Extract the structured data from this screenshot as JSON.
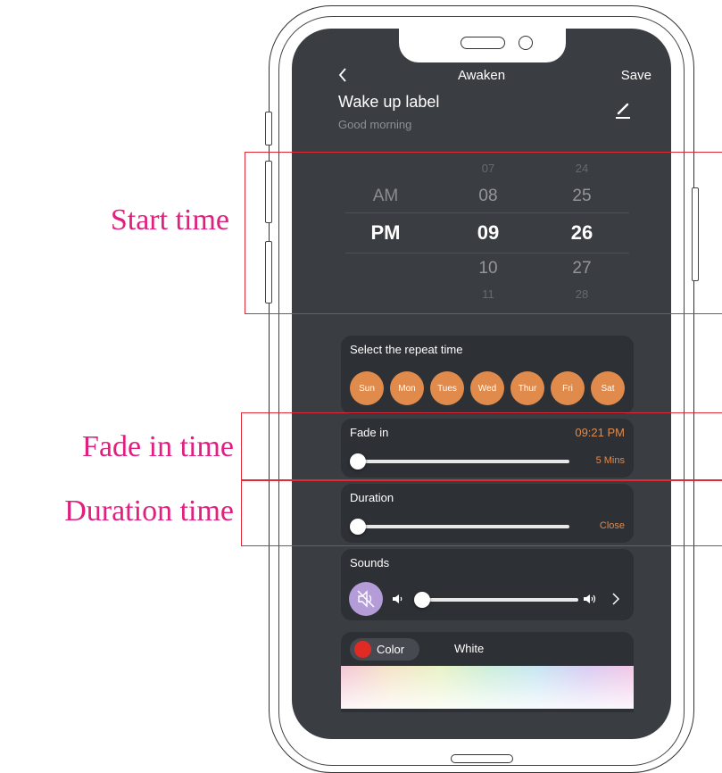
{
  "header": {
    "title": "Awaken",
    "save_label": "Save",
    "back_icon": "chevron-left-icon"
  },
  "wake_label": {
    "title": "Wake up label",
    "subtitle": "Good morning",
    "edit_icon": "pencil-icon"
  },
  "time_picker": {
    "period": [
      "AM",
      "PM"
    ],
    "hours": [
      "07",
      "08",
      "09",
      "10",
      "11"
    ],
    "minutes": [
      "24",
      "25",
      "26",
      "27",
      "28"
    ],
    "selected": {
      "period": "PM",
      "hour": "09",
      "minute": "26"
    }
  },
  "repeat": {
    "label": "Select the repeat time",
    "days": [
      "Sun",
      "Mon",
      "Tues",
      "Wed",
      "Thur",
      "Fri",
      "Sat"
    ]
  },
  "fade_in": {
    "label": "Fade in",
    "time": "09:21 PM",
    "value_label": "5 Mins",
    "slider_level": 0
  },
  "duration": {
    "label": "Duration",
    "value_label": "Close",
    "slider_level": 0
  },
  "sounds": {
    "label": "Sounds",
    "mute_icon": "speaker-muted-icon",
    "volume_level": 0
  },
  "color": {
    "chip_label": "Color",
    "white_label": "White",
    "selected_color": "#e02b25"
  },
  "annotations": {
    "start_time": "Start time",
    "fade_in_time": "Fade in time",
    "duration_time": "Duration time"
  },
  "colors": {
    "background": "#3a3d42",
    "card": "#2d3035",
    "accent": "#e08a4b",
    "annotation_text": "#e0207e",
    "annotation_box": "#e02a37",
    "sound_button": "#b49cd8"
  }
}
